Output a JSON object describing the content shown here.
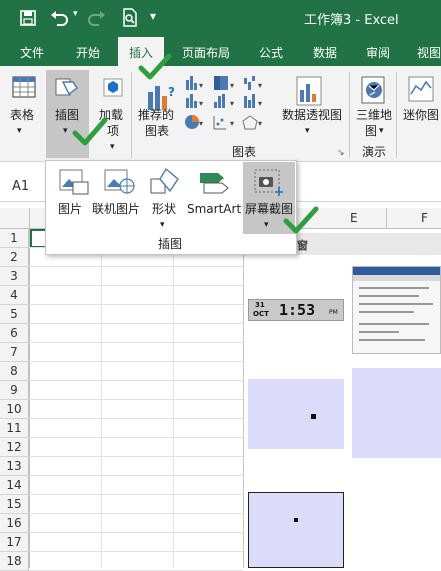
{
  "colors": {
    "brand": "#217346",
    "ribbon_bg": "#f3f3f3",
    "thumb_bg": "#dcdcfa",
    "check": "#2e9e3e"
  },
  "titlebar": {
    "title": "工作簿3 - Excel"
  },
  "tabs": [
    {
      "label": "文件"
    },
    {
      "label": "开始"
    },
    {
      "label": "插入"
    },
    {
      "label": "页面布局"
    },
    {
      "label": "公式"
    },
    {
      "label": "数据"
    },
    {
      "label": "审阅"
    },
    {
      "label": "视图"
    }
  ],
  "ribbon": {
    "table_label": "表格",
    "illustrations_label": "插图",
    "addins_label_1": "加载",
    "addins_label_2": "项",
    "recommended_label_1": "推荐的",
    "recommended_label_2": "图表",
    "pivotchart_label": "数据透视图",
    "map3d_label_1": "三维地",
    "map3d_label_2": "图",
    "sparkline_label": "迷你图",
    "charts_group": "图表",
    "tours_group": "演示"
  },
  "formula": {
    "namebox": "A1"
  },
  "dropdown": {
    "items": [
      {
        "label": "图片"
      },
      {
        "label": "联机图片"
      },
      {
        "label": "形状"
      },
      {
        "label": "SmartArt"
      },
      {
        "label": "屏幕截图"
      }
    ],
    "group_label": "插图"
  },
  "gallery": {
    "header": "可用的视窗",
    "clock_date_top": "31",
    "clock_date_bottom": "OCT",
    "clock_time": "1:53",
    "clock_suffix": "PM"
  },
  "columns": [
    "E",
    "F"
  ],
  "rows": [
    "1",
    "2",
    "3",
    "4",
    "5",
    "6",
    "7",
    "8",
    "9",
    "10",
    "11",
    "12",
    "13",
    "14",
    "15",
    "16",
    "17",
    "18"
  ]
}
